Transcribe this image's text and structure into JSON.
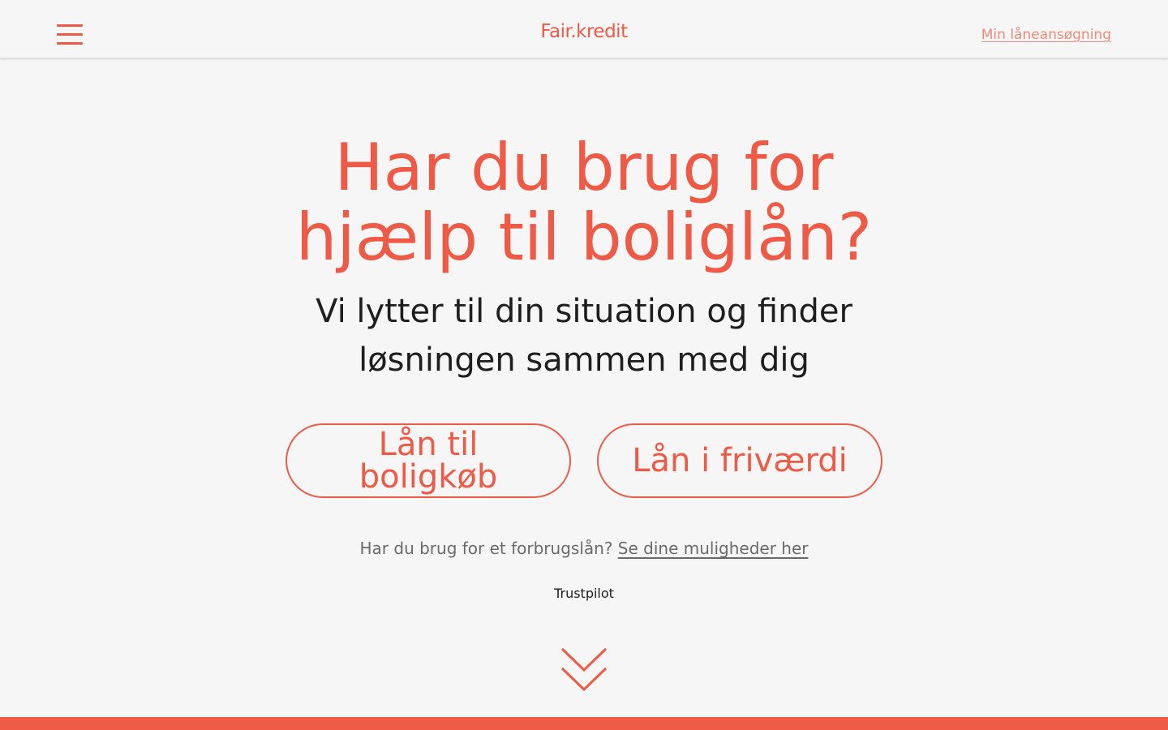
{
  "header": {
    "logo_text": "Fair.kredit",
    "account_link": "Min låneansøgning"
  },
  "hero": {
    "headline_line1": "Har du brug for",
    "headline_line2": "hjælp til boliglån?",
    "subhead_line1": "Vi lytter til din situation og finder",
    "subhead_line2": "løsningen sammen med dig"
  },
  "actions": {
    "home_purchase_loan": "Lån til boligkøb",
    "equity_loan": "Lån i friværdi"
  },
  "consumer_loan": {
    "question": "Har du brug for et forbrugslån?",
    "link": "Se dine muligheder her"
  },
  "trustpilot": {
    "label": "Trustpilot"
  },
  "icons": {
    "menu": "hamburger-menu-icon",
    "scroll": "double-chevron-down-icon"
  },
  "colors": {
    "accent": "#ee5a45",
    "background": "#f6f6f6",
    "text": "#1e1e1e",
    "muted": "#6a6a6a"
  }
}
